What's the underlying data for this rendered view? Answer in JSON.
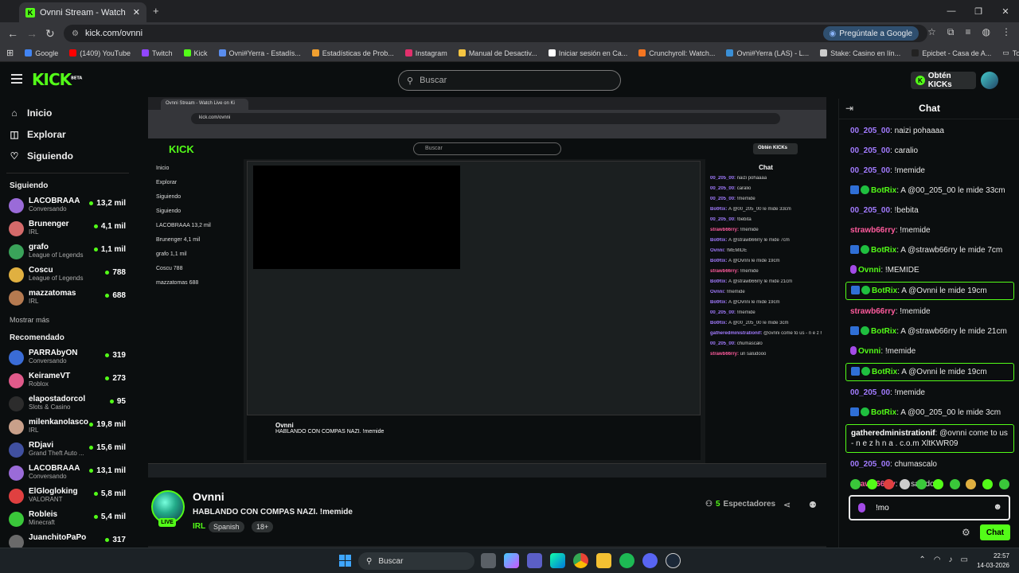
{
  "browser": {
    "tab_title": "Ovnni Stream - Watch Live on Ki",
    "url": "kick.com/ovnni",
    "ask_google": "Pregúntale a Google",
    "bookmarks": [
      {
        "label": "Google",
        "color": "#4285f4"
      },
      {
        "label": "(1409) YouTube",
        "color": "#ff0000"
      },
      {
        "label": "Twitch",
        "color": "#9146ff"
      },
      {
        "label": "Kick",
        "color": "#53fc18"
      },
      {
        "label": "Ovni#Yerra - Estadís...",
        "color": "#5a8dee"
      },
      {
        "label": "Estadísticas de Prob...",
        "color": "#f0a030"
      },
      {
        "label": "Instagram",
        "color": "#e1306c"
      },
      {
        "label": "Manual de Desactiv...",
        "color": "#f5c542"
      },
      {
        "label": "Iniciar sesión en Ca...",
        "color": "#ffffff"
      },
      {
        "label": "Crunchyroll: Watch...",
        "color": "#f47521"
      },
      {
        "label": "Ovni#Yerra (LAS) - L...",
        "color": "#3a8fd6"
      },
      {
        "label": "Stake: Casino en lín...",
        "color": "#cccccc"
      },
      {
        "label": "Epicbet - Casa de A...",
        "color": "#222222"
      }
    ],
    "all_favorites": "Todos los favoritos"
  },
  "header": {
    "logo": "KICK",
    "logo_beta": "BETA",
    "search_placeholder": "Buscar",
    "kicks_button": "Obtén KICKs"
  },
  "sidebar": {
    "nav": [
      {
        "label": "Inicio",
        "icon": "home-icon"
      },
      {
        "label": "Explorar",
        "icon": "compass-icon"
      },
      {
        "label": "Siguiendo",
        "icon": "heart-icon"
      }
    ],
    "following_title": "Siguiendo",
    "following": [
      {
        "name": "LACOBRAAA",
        "category": "Conversando",
        "viewers": "13,2 mil",
        "color": "#9a6bd8"
      },
      {
        "name": "Brunenger",
        "category": "IRL",
        "viewers": "4,1 mil",
        "color": "#d46a6a"
      },
      {
        "name": "grafo",
        "category": "League of Legends",
        "viewers": "1,1 mil",
        "color": "#3aa35a"
      },
      {
        "name": "Coscu",
        "category": "League of Legends",
        "viewers": "788",
        "color": "#e0b040"
      },
      {
        "name": "mazzatomas",
        "category": "IRL",
        "viewers": "688",
        "color": "#b57a50"
      }
    ],
    "show_more": "Mostrar más",
    "recommended_title": "Recomendado",
    "recommended": [
      {
        "name": "PARRAbyON",
        "category": "Conversando",
        "viewers": "319",
        "color": "#3a6cd6"
      },
      {
        "name": "KeirameVT",
        "category": "Roblox",
        "viewers": "273",
        "color": "#e05a8a"
      },
      {
        "name": "elapostadorcol",
        "category": "Slots & Casino",
        "viewers": "95",
        "color": "#2c2c2c"
      },
      {
        "name": "milenkanolasco",
        "category": "IRL",
        "viewers": "19,8 mil",
        "color": "#c9a08a"
      },
      {
        "name": "RDjavi",
        "category": "Grand Theft Auto ...",
        "viewers": "15,6 mil",
        "color": "#4050a0"
      },
      {
        "name": "LACOBRAAA",
        "category": "Conversando",
        "viewers": "13,1 mil",
        "color": "#9a6bd8"
      },
      {
        "name": "ElGlogloking",
        "category": "VALORANT",
        "viewers": "5,8 mil",
        "color": "#e04040"
      },
      {
        "name": "Robleis",
        "category": "Minecraft",
        "viewers": "5,4 mil",
        "color": "#3ac73a"
      },
      {
        "name": "JuanchitoPaPo",
        "category": "",
        "viewers": "317",
        "color": "#6a6a6a"
      }
    ]
  },
  "stream": {
    "name": "Ovnni",
    "title": "HABLANDO CON COMPAS NAZI. !memide",
    "category": "IRL",
    "tags": [
      "Spanish",
      "18+"
    ],
    "live": "LIVE",
    "viewers": "5",
    "viewers_label": "Espectadores"
  },
  "nested": {
    "nav": [
      "Inicio",
      "Explorar",
      "Siguiendo"
    ],
    "chat_title": "Chat",
    "chat_lines": [
      {
        "user": "00_205_00",
        "text": "naizi pohaaaa"
      },
      {
        "user": "00_205_00",
        "text": "caralio"
      },
      {
        "user": "00_205_00",
        "text": "!memide"
      },
      {
        "user": "BotRix",
        "text": "A @00_205_00 le mide 33cm"
      },
      {
        "user": "00_205_00",
        "text": "!bebita"
      },
      {
        "user": "strawb66rry",
        "text": "!memide"
      },
      {
        "user": "BotRix",
        "text": "A @strawb66rry le mide 7cm"
      },
      {
        "user": "Ovnni",
        "text": "!MEMIDE"
      },
      {
        "user": "BotRix",
        "text": "A @Ovnni le mide 19cm"
      },
      {
        "user": "strawb66rry",
        "text": "!memide"
      },
      {
        "user": "BotRix",
        "text": "A @strawb66rry le mide 21cm"
      },
      {
        "user": "Ovnni",
        "text": "!memide"
      },
      {
        "user": "BotRix",
        "text": "A @Ovnni le mide 19cm"
      },
      {
        "user": "00_205_00",
        "text": "!memide"
      },
      {
        "user": "BotRix",
        "text": "A @00_205_00 le mide 3cm"
      },
      {
        "user": "gatheredministrationif",
        "text": "@ovnni come to us - n e z h n a . c.o.m XltKWR09"
      },
      {
        "user": "00_205_00",
        "text": "chumascalo"
      },
      {
        "user": "strawb66rry",
        "text": "un saludooo"
      }
    ]
  },
  "chat": {
    "title": "Chat",
    "messages": [
      {
        "user": "00_205_00",
        "text": "naizi pohaaaa",
        "color": "#a27bff",
        "badges": [],
        "highlight": false
      },
      {
        "user": "00_205_00",
        "text": "caralio",
        "color": "#a27bff",
        "badges": [],
        "highlight": false
      },
      {
        "user": "00_205_00",
        "text": "!memide",
        "color": "#a27bff",
        "badges": [],
        "highlight": false
      },
      {
        "user": "BotRix",
        "text": "A @00_205_00 le mide 33cm",
        "color": "#53fc18",
        "badges": [
          "bot",
          "verified"
        ],
        "highlight": false
      },
      {
        "user": "00_205_00",
        "text": "!bebita",
        "color": "#a27bff",
        "badges": [],
        "highlight": false
      },
      {
        "user": "strawb66rry",
        "text": "!memide",
        "color": "#ff5b9d",
        "badges": [],
        "highlight": false
      },
      {
        "user": "BotRix",
        "text": "A @strawb66rry le mide 7cm",
        "color": "#53fc18",
        "badges": [
          "bot",
          "verified"
        ],
        "highlight": false
      },
      {
        "user": "Ovnni",
        "text": "!MEMIDE",
        "color": "#53fc18",
        "badges": [
          "mic"
        ],
        "highlight": false
      },
      {
        "user": "BotRix",
        "text": "A @Ovnni le mide 19cm",
        "color": "#53fc18",
        "badges": [
          "bot",
          "verified"
        ],
        "highlight": true
      },
      {
        "user": "strawb66rry",
        "text": "!memide",
        "color": "#ff5b9d",
        "badges": [],
        "highlight": false
      },
      {
        "user": "BotRix",
        "text": "A @strawb66rry le mide 21cm",
        "color": "#53fc18",
        "badges": [
          "bot",
          "verified"
        ],
        "highlight": false
      },
      {
        "user": "Ovnni",
        "text": "!memide",
        "color": "#53fc18",
        "badges": [
          "mic"
        ],
        "highlight": false
      },
      {
        "user": "BotRix",
        "text": "A @Ovnni le mide 19cm",
        "color": "#53fc18",
        "badges": [
          "bot",
          "verified"
        ],
        "highlight": true
      },
      {
        "user": "00_205_00",
        "text": "!memide",
        "color": "#a27bff",
        "badges": [],
        "highlight": false
      },
      {
        "user": "BotRix",
        "text": "A @00_205_00 le mide 3cm",
        "color": "#53fc18",
        "badges": [
          "bot",
          "verified"
        ],
        "highlight": false
      },
      {
        "user": "gatheredministrationif",
        "text": "@ovnni come to us - n e z h n a . c.o.m XltKWR09",
        "color": "#ffffff",
        "badges": [],
        "highlight": true
      },
      {
        "user": "00_205_00",
        "text": "chumascalo",
        "color": "#a27bff",
        "badges": [],
        "highlight": false
      },
      {
        "user": "strawb66rry",
        "text": "un saludooo",
        "color": "#ff5b9d",
        "badges": [],
        "highlight": false
      }
    ],
    "input_value": "!mo",
    "send_label": "Chat"
  },
  "taskbar": {
    "search_label": "Buscar",
    "time": "22:57",
    "date": "14-03-2026"
  }
}
